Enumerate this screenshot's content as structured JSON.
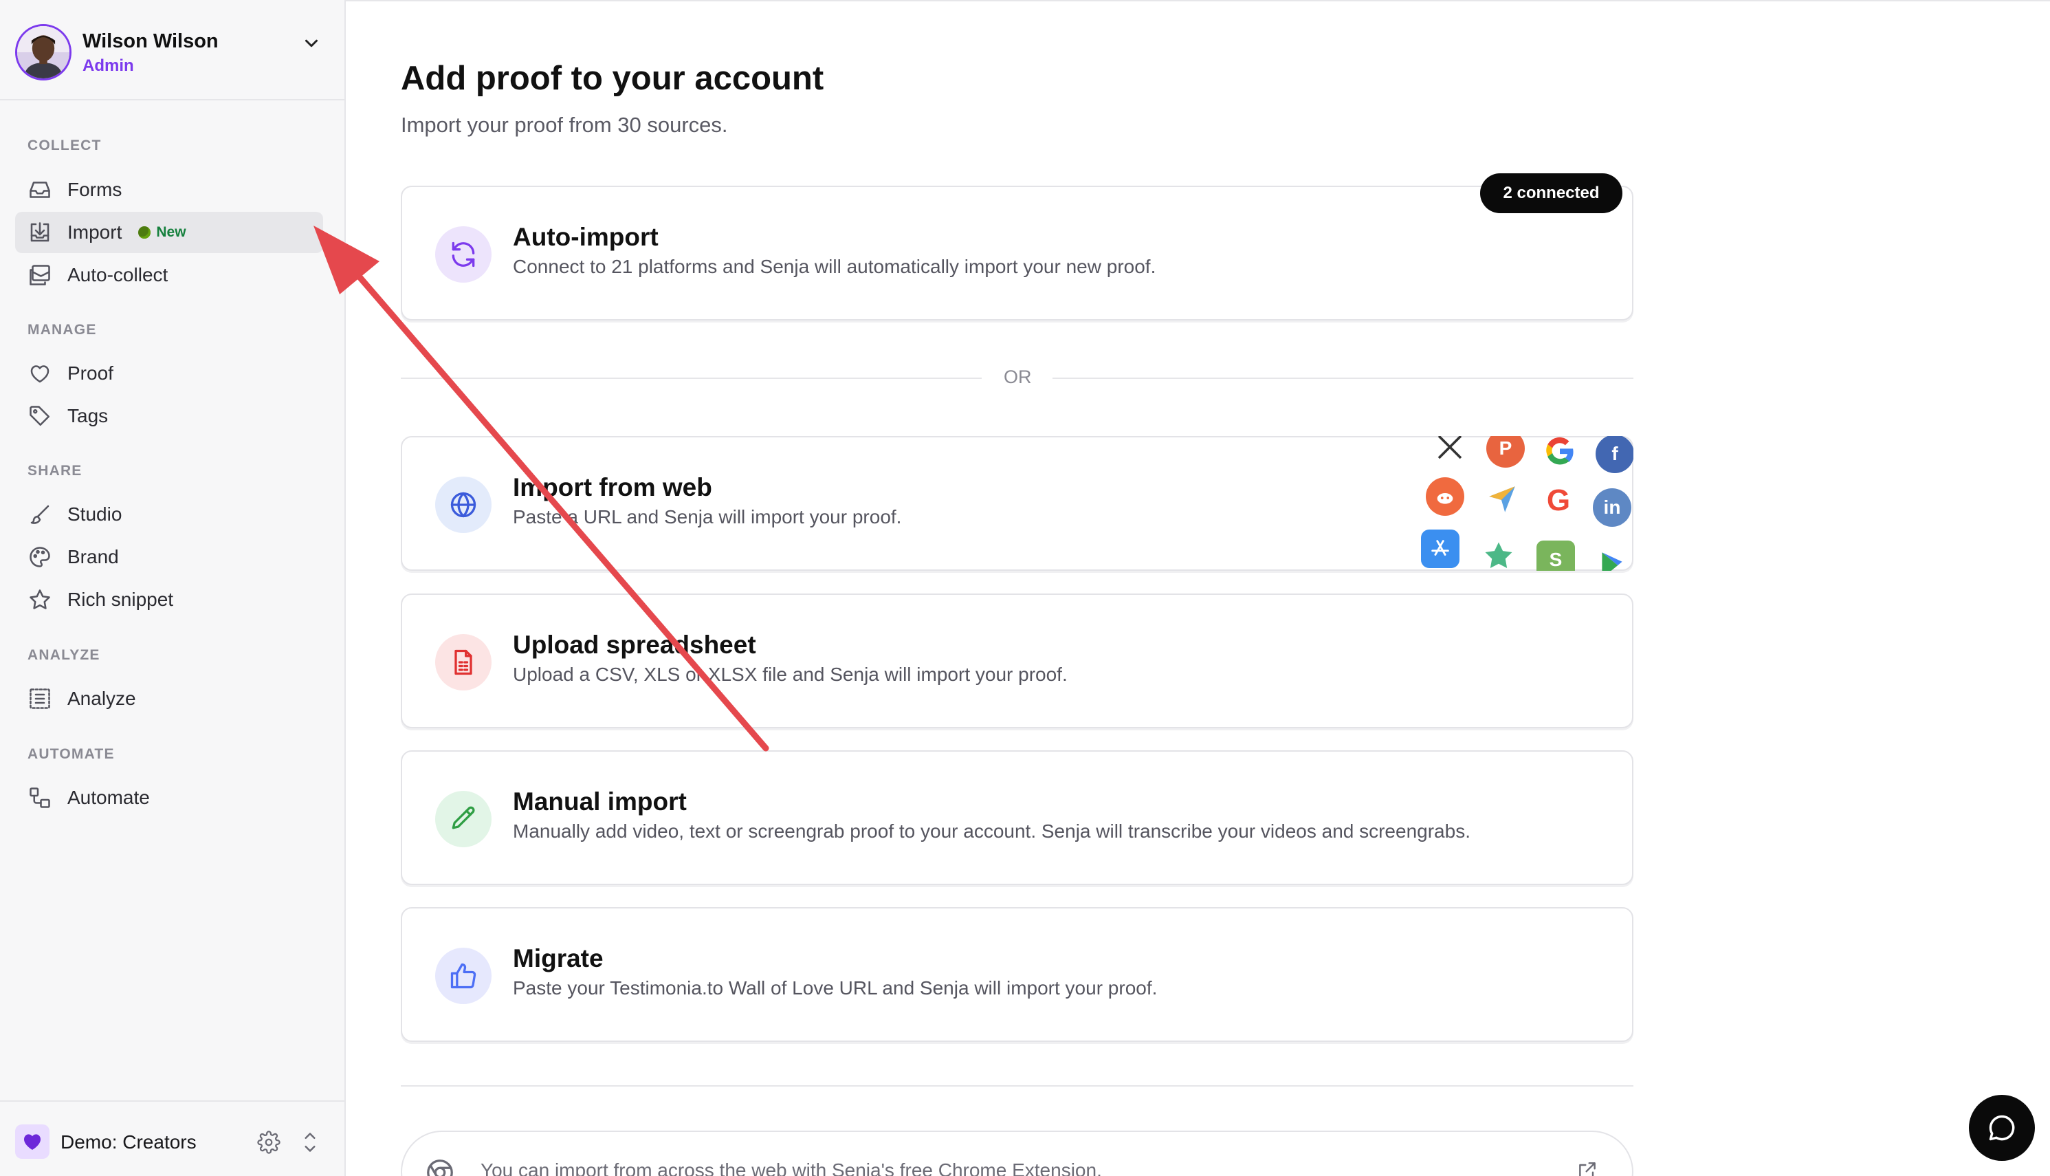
{
  "user": {
    "name": "Wilson Wilson",
    "role": "Admin"
  },
  "sidebar": {
    "sections": {
      "collect": "COLLECT",
      "manage": "MANAGE",
      "share": "SHARE",
      "analyze": "ANALYZE",
      "automate": "AUTOMATE"
    },
    "items": [
      {
        "label": "Forms",
        "icon": "inbox-icon"
      },
      {
        "label": "Import",
        "icon": "import-icon",
        "badge": "New",
        "active": true
      },
      {
        "label": "Auto-collect",
        "icon": "auto-collect-icon"
      },
      {
        "label": "Proof",
        "icon": "heart-icon"
      },
      {
        "label": "Tags",
        "icon": "tag-icon"
      },
      {
        "label": "Studio",
        "icon": "brush-icon"
      },
      {
        "label": "Brand",
        "icon": "palette-icon"
      },
      {
        "label": "Rich snippet",
        "icon": "star-icon"
      },
      {
        "label": "Analyze",
        "icon": "list-icon"
      },
      {
        "label": "Automate",
        "icon": "workflow-icon"
      }
    ]
  },
  "workspace": {
    "name": "Demo: Creators"
  },
  "main": {
    "title": "Add proof to your account",
    "subtitle": "Import your proof from 30 sources.",
    "or_label": "OR",
    "connected_badge": "2 connected",
    "cards": [
      {
        "title": "Auto-import",
        "description": "Connect to 21 platforms and Senja will automatically import your new proof.",
        "icon": "refresh-icon",
        "color": "#7c3aed"
      },
      {
        "title": "Import from web",
        "description": "Paste a URL and Senja will import your proof.",
        "icon": "globe-icon",
        "color": "#3b5bdb"
      },
      {
        "title": "Upload spreadsheet",
        "description": "Upload a CSV, XLS or XLSX file and Senja will import your proof.",
        "icon": "spreadsheet-icon",
        "color": "#e03131"
      },
      {
        "title": "Manual import",
        "description": "Manually add video, text or screengrab proof to your account. Senja will transcribe your videos and screengrabs.",
        "icon": "pencil-icon",
        "color": "#2f9e44"
      },
      {
        "title": "Migrate",
        "description": "Paste your Testimonia.to Wall of Love URL and Senja will import your proof.",
        "icon": "thumbs-up-icon",
        "color": "#4c6ef5"
      }
    ],
    "extension_text": "You can import from across the web with Senja's free Chrome Extension.",
    "logos": [
      "x-logo",
      "product-hunt-logo",
      "google-logo",
      "facebook-logo",
      "reddit-logo",
      "capterra-logo",
      "g2-logo",
      "linkedin-logo",
      "app-store-logo",
      "trustpilot-logo",
      "shopify-logo",
      "google-play-logo"
    ]
  },
  "colors": {
    "accent": "#7c3aed",
    "annotation_arrow": "#e5484d"
  }
}
